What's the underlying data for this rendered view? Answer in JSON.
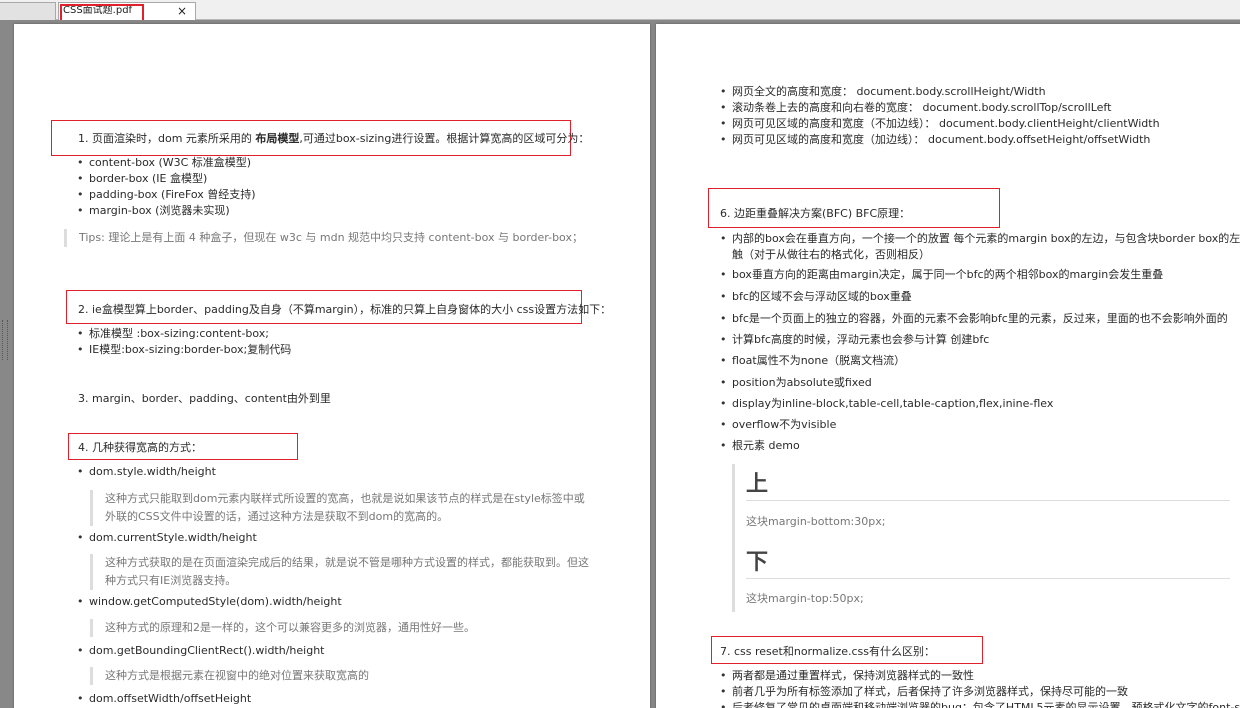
{
  "tabs": {
    "active_title": "CSS面试题.pdf",
    "close_glyph": "×"
  },
  "left_page": {
    "q1": {
      "prefix": "1. 页面渲染时，dom 元素所采用的 ",
      "bold": "布局模型",
      "suffix": ",可通过box-sizing进行设置。根据计算宽高的区域可分为：",
      "items": [
        "content-box (W3C 标准盒模型)",
        "border-box (IE 盒模型)",
        "padding-box (FireFox 曾经支持)",
        "margin-box (浏览器未实现)"
      ],
      "tips": "Tips: 理论上是有上面 4 种盒子，但现在 w3c 与 mdn 规范中均只支持 content-box 与 border-box；"
    },
    "q2": {
      "title": "2. ie盒模型算上border、padding及自身（不算margin），标准的只算上自身窗体的大小 css设置方法如下：",
      "items": [
        "标准模型 :box-sizing:content-box;",
        "IE模型:box-sizing:border-box;复制代码"
      ]
    },
    "q3": {
      "title": "3. margin、border、padding、content由外到里"
    },
    "q4": {
      "title": "4. 几种获得宽高的方式：",
      "items": [
        {
          "label": "dom.style.width/height",
          "desc": "这种方式只能取到dom元素内联样式所设置的宽高，也就是说如果该节点的样式是在style标签中或外联的CSS文件中设置的话，通过这种方法是获取不到dom的宽高的。"
        },
        {
          "label": "dom.currentStyle.width/height",
          "desc": "这种方式获取的是在页面渲染完成后的结果，就是说不管是哪种方式设置的样式，都能获取到。但这种方式只有IE浏览器支持。"
        },
        {
          "label": "window.getComputedStyle(dom).width/height",
          "desc": "这种方式的原理和2是一样的，这个可以兼容更多的浏览器，通用性好一些。"
        },
        {
          "label": "dom.getBoundingClientRect().width/height",
          "desc": "这种方式是根据元素在视窗中的绝对位置来获取宽高的"
        },
        {
          "label": "dom.offsetWidth/offsetHeight",
          "desc": ""
        }
      ]
    }
  },
  "right_page": {
    "top_items": [
      "网页全文的高度和宽度： document.body.scrollHeight/Width",
      "滚动条卷上去的高度和向右卷的宽度： document.body.scrollTop/scrollLeft",
      "网页可见区域的高度和宽度（不加边线）： document.body.clientHeight/clientWidth",
      "网页可见区域的高度和宽度（加边线）： document.body.offsetHeight/offsetWidth"
    ],
    "q6": {
      "title": "6. 边距重叠解决方案(BFC) BFC原理：",
      "items": [
        "内部的box会在垂直方向，一个接一个的放置 每个元素的margin box的左边，与包含块border box的左边相接",
        "触（对于从做往右的格式化，否则相反）",
        "box垂直方向的距离由margin决定，属于同一个bfc的两个相邻box的margin会发生重叠",
        "bfc的区域不会与浮动区域的box重叠",
        "bfc是一个页面上的独立的容器，外面的元素不会影响bfc里的元素，反过来，里面的也不会影响外面的",
        "计算bfc高度的时候，浮动元素也会参与计算 创建bfc",
        "float属性不为none（脱离文档流）",
        "position为absolute或fixed",
        "display为inline-block,table-cell,table-caption,flex,inine-flex",
        "overflow不为visible",
        "根元素 demo"
      ],
      "demo": {
        "top_char": "上",
        "top_text": "这块margin-bottom:30px;",
        "bottom_char": "下",
        "bottom_text": "这块margin-top:50px;"
      }
    },
    "q7": {
      "title": "7. css reset和normalize.css有什么区别：",
      "items": [
        "两者都是通过重置样式，保持浏览器样式的一致性",
        "前者几乎为所有标签添加了样式，后者保持了许多浏览器样式，保持尽可能的一致",
        "后者修复了常见的桌面端和移动端浏览器的bug：包含了HTML5元素的显示设置，预格式化文字的font-size问"
      ]
    }
  }
}
